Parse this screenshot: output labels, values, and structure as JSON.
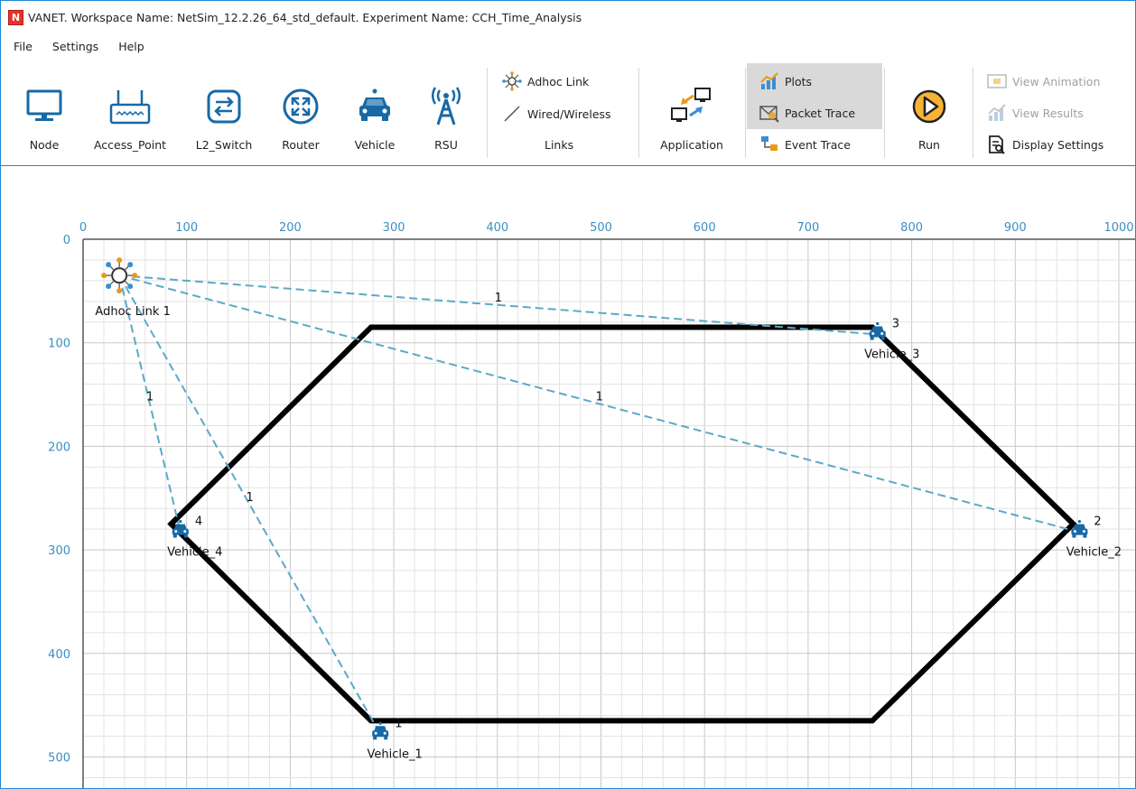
{
  "window": {
    "title": "VANET. Workspace Name: NetSim_12.2.26_64_std_default. Experiment Name: CCH_Time_Analysis",
    "logo_text": "N"
  },
  "menu": [
    "File",
    "Settings",
    "Help"
  ],
  "toolbar": {
    "node": "Node",
    "access_point": "Access_Point",
    "l2_switch": "L2_Switch",
    "router": "Router",
    "vehicle": "Vehicle",
    "rsu": "RSU",
    "adhoc_link": "Adhoc Link",
    "wired_wireless": "Wired/Wireless",
    "links": "Links",
    "application": "Application",
    "plots": "Plots",
    "packet_trace": "Packet Trace",
    "event_trace": "Event Trace",
    "run": "Run",
    "view_animation": "View Animation",
    "view_results": "View Results",
    "display_settings": "Display Settings"
  },
  "colors": {
    "accent": "#1f8ad6",
    "tick": "#3a8fc4",
    "link_dashed": "#5aa9c9",
    "road": "#000000",
    "vehicle": "#1769a6"
  },
  "grid": {
    "x_ticks": [
      0,
      100,
      200,
      300,
      400,
      500,
      600,
      700,
      800,
      900,
      1000
    ],
    "y_ticks": [
      0,
      100,
      200,
      300,
      400,
      500
    ]
  },
  "road_path": [
    [
      278,
      85
    ],
    [
      762,
      85
    ],
    [
      956,
      275
    ],
    [
      762,
      465
    ],
    [
      278,
      465
    ],
    [
      85,
      275
    ]
  ],
  "devices": [
    {
      "name": "Adhoc Link 1",
      "type": "adhoc",
      "x": 35,
      "y": 35
    },
    {
      "name": "Vehicle_1",
      "type": "vehicle",
      "id": "1",
      "x": 287,
      "y": 478
    },
    {
      "name": "Vehicle_2",
      "type": "vehicle",
      "id": "2",
      "x": 962,
      "y": 283
    },
    {
      "name": "Vehicle_3",
      "type": "vehicle",
      "id": "3",
      "x": 767,
      "y": 92
    },
    {
      "name": "Vehicle_4",
      "type": "vehicle",
      "id": "4",
      "x": 94,
      "y": 283
    }
  ],
  "links": [
    {
      "from": "Adhoc Link 1",
      "to": "Vehicle_1",
      "label": "1"
    },
    {
      "from": "Adhoc Link 1",
      "to": "Vehicle_2",
      "label": "1"
    },
    {
      "from": "Adhoc Link 1",
      "to": "Vehicle_3",
      "label": "1"
    },
    {
      "from": "Adhoc Link 1",
      "to": "Vehicle_4",
      "label": "1"
    }
  ]
}
